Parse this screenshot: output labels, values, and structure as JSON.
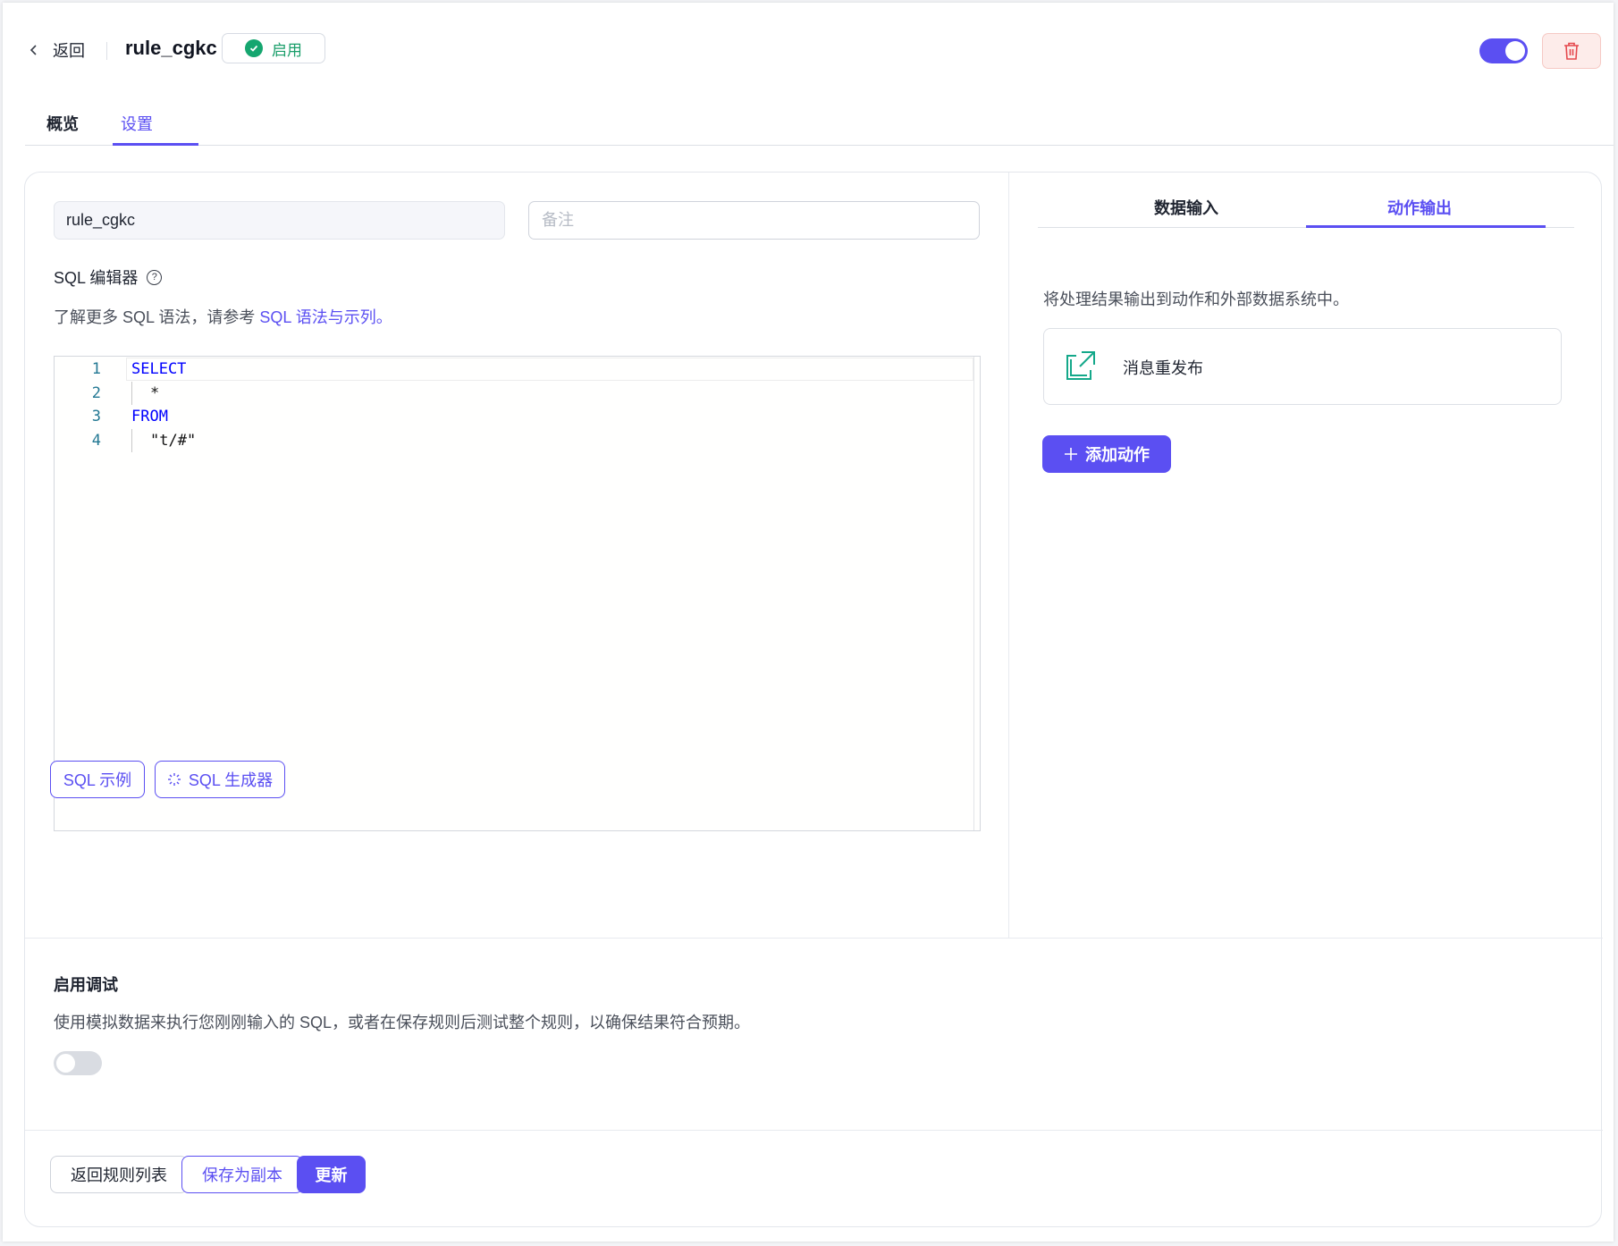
{
  "header": {
    "back_label": "返回",
    "rule_name": "rule_cgkc",
    "status_label": "启用",
    "enabled": true
  },
  "tabs": [
    {
      "label": "概览",
      "active": false
    },
    {
      "label": "设置",
      "active": true
    }
  ],
  "form": {
    "name_value": "rule_cgkc",
    "note_placeholder": "备注",
    "sql_editor_label": "SQL 编辑器",
    "sql_hint_prefix": "了解更多 SQL 语法，请参考 ",
    "sql_hint_link": "SQL 语法与示列。"
  },
  "editor": {
    "lines": [
      {
        "num": "1",
        "text": "SELECT",
        "keyword": true,
        "indent": false
      },
      {
        "num": "2",
        "text": "*",
        "keyword": false,
        "indent": true
      },
      {
        "num": "3",
        "text": "FROM",
        "keyword": true,
        "indent": false
      },
      {
        "num": "4",
        "text": "\"t/#\"",
        "keyword": false,
        "indent": true
      }
    ]
  },
  "editor_buttons": {
    "sql_example": "SQL 示例",
    "sql_generator": "SQL 生成器"
  },
  "right_panel": {
    "tabs": [
      {
        "label": "数据输入",
        "active": false
      },
      {
        "label": "动作输出",
        "active": true
      }
    ],
    "description": "将处理结果输出到动作和外部数据系统中。",
    "actions": [
      {
        "label": "消息重发布",
        "icon": "republish-icon"
      }
    ],
    "add_action_label": "添加动作"
  },
  "debug": {
    "title": "启用调试",
    "description": "使用模拟数据来执行您刚刚输入的 SQL，或者在保存规则后测试整个规则，以确保结果符合预期。",
    "enabled": false
  },
  "footer": {
    "back_to_list": "返回规则列表",
    "save_as_copy": "保存为副本",
    "update": "更新"
  },
  "colors": {
    "accent": "#5b4ff2",
    "success": "#15a66f",
    "danger": "#e5484d",
    "action_icon": "#14a88a"
  }
}
